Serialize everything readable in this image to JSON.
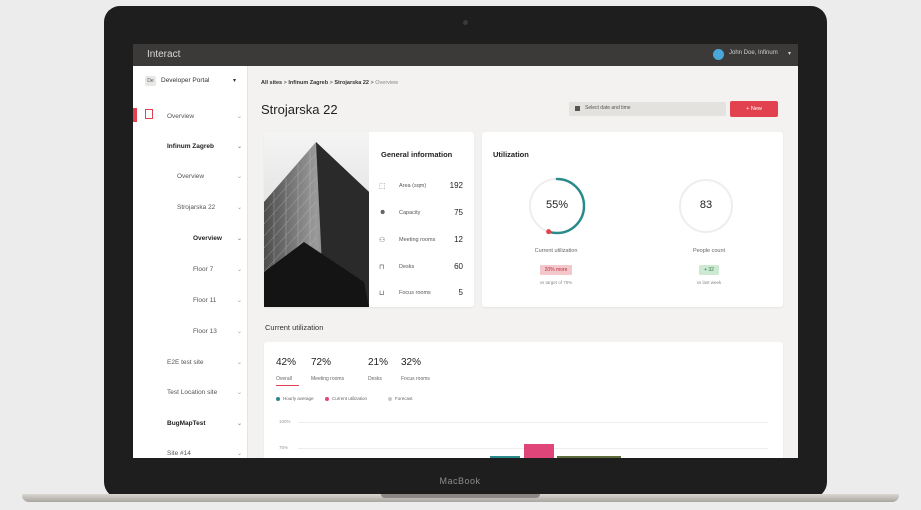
{
  "device": {
    "brand": "MacBook"
  },
  "app": {
    "title": "Interact",
    "user_name": "John Doe, Infinum"
  },
  "sidebar": {
    "portal_badge": "De",
    "portal_label": "Developer Portal",
    "items": [
      {
        "label": "Overview"
      },
      {
        "label": "Infinum Zagreb"
      },
      {
        "label": "Overview"
      },
      {
        "label": "Strojarska 22"
      },
      {
        "label": "Overview"
      },
      {
        "label": "Floor 7"
      },
      {
        "label": "Floor 11"
      },
      {
        "label": "Floor 13"
      },
      {
        "label": "E2E test site"
      },
      {
        "label": "Test Location site"
      },
      {
        "label": "BugMapTest"
      },
      {
        "label": "Site #14"
      }
    ]
  },
  "breadcrumb": {
    "all": "All sites",
    "city": "Infinum Zagreb",
    "building": "Strojarska 22",
    "current": "Overview",
    "sep": ">"
  },
  "page": {
    "title": "Strojarska 22",
    "date_placeholder": "Select date and time",
    "new_button": "+ New"
  },
  "general_info": {
    "title": "General information",
    "rows": [
      {
        "icon": "area-icon",
        "glyph": "⬚",
        "label": "Area (sqm)",
        "value": "192"
      },
      {
        "icon": "capacity-icon",
        "glyph": "☻",
        "label": "Capacity",
        "value": "75"
      },
      {
        "icon": "meeting-rooms-icon",
        "glyph": "⚇",
        "label": "Meeting rooms",
        "value": "12"
      },
      {
        "icon": "desks-icon",
        "glyph": "⊓",
        "label": "Desks",
        "value": "60"
      },
      {
        "icon": "focus-rooms-icon",
        "glyph": "⊔",
        "label": "Focus rooms",
        "value": "5"
      }
    ]
  },
  "utilization": {
    "title": "Utilization",
    "current": {
      "value": "55%",
      "label": "Current utilization",
      "tag": "20% more",
      "note": "vs target of 75%",
      "fraction": 0.55
    },
    "people": {
      "value": "83",
      "label": "People count",
      "tag": "+ 32",
      "note": "vs last week"
    }
  },
  "current_utilization": {
    "title": "Current utilization",
    "stats": [
      {
        "value": "42%",
        "label": "Overall"
      },
      {
        "value": "72%",
        "label": "Meeting rooms"
      },
      {
        "value": "21%",
        "label": "Desks"
      },
      {
        "value": "32%",
        "label": "Focus rooms"
      }
    ],
    "legend": [
      {
        "label": "Hourly average"
      },
      {
        "label": "Current utilization"
      },
      {
        "label": "Forecast"
      }
    ],
    "y_ticks": [
      "100%",
      "75%"
    ]
  },
  "colors": {
    "accent": "#e2414f",
    "teal": "#2b8a8a",
    "pink": "#e0457a"
  }
}
